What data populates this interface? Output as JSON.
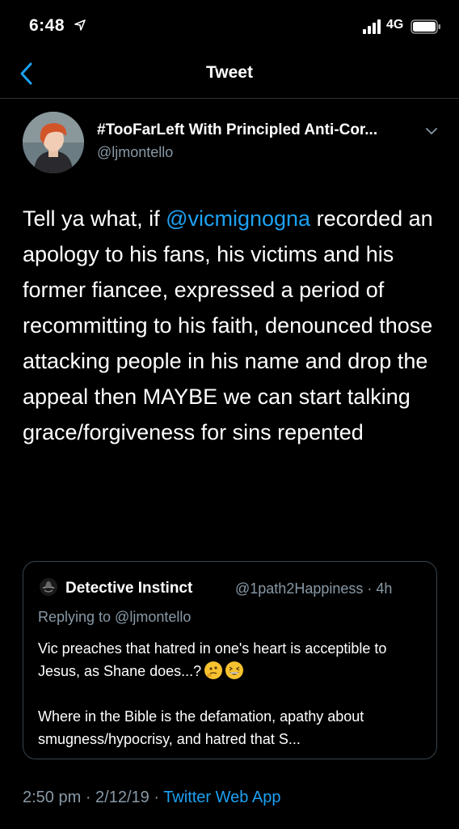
{
  "status_bar": {
    "time": "6:48",
    "network": "4G",
    "icons": [
      "location-arrow-icon",
      "signal-bars-icon",
      "battery-icon"
    ]
  },
  "nav": {
    "title": "Tweet",
    "back_icon": "chevron-left-icon"
  },
  "tweet": {
    "author_name": "#TooFarLeft With Principled Anti-Cor...",
    "author_handle": "@ljmontello",
    "text_before": "Tell ya what, if ",
    "mention": "@vicmignogna",
    "text_after": " recorded an apology to his fans, his victims and his former fiancee, expressed a period of recommitting to his faith, denounced those attacking people in his name and drop the appeal then MAYBE we can start talking grace/forgiveness for sins repented"
  },
  "quote": {
    "name": "Detective Instinct",
    "handle_time": "@1path2Happiness · 4h",
    "replying_to": "Replying to @ljmontello",
    "body_line1": "Vic preaches that hatred in one's heart is acceptible to Jesus, as Shane does...?",
    "body_line2": "Where in the Bible is the defamation, apathy about smugness/hypocrisy, and hatred that S..."
  },
  "meta": {
    "timestamp": "2:50 pm · 2/12/19 · ",
    "app": "Twitter Web App"
  },
  "colors": {
    "background": "#000000",
    "accent": "#1da1f2",
    "secondary_text": "#8899a6",
    "border": "#38444d"
  }
}
